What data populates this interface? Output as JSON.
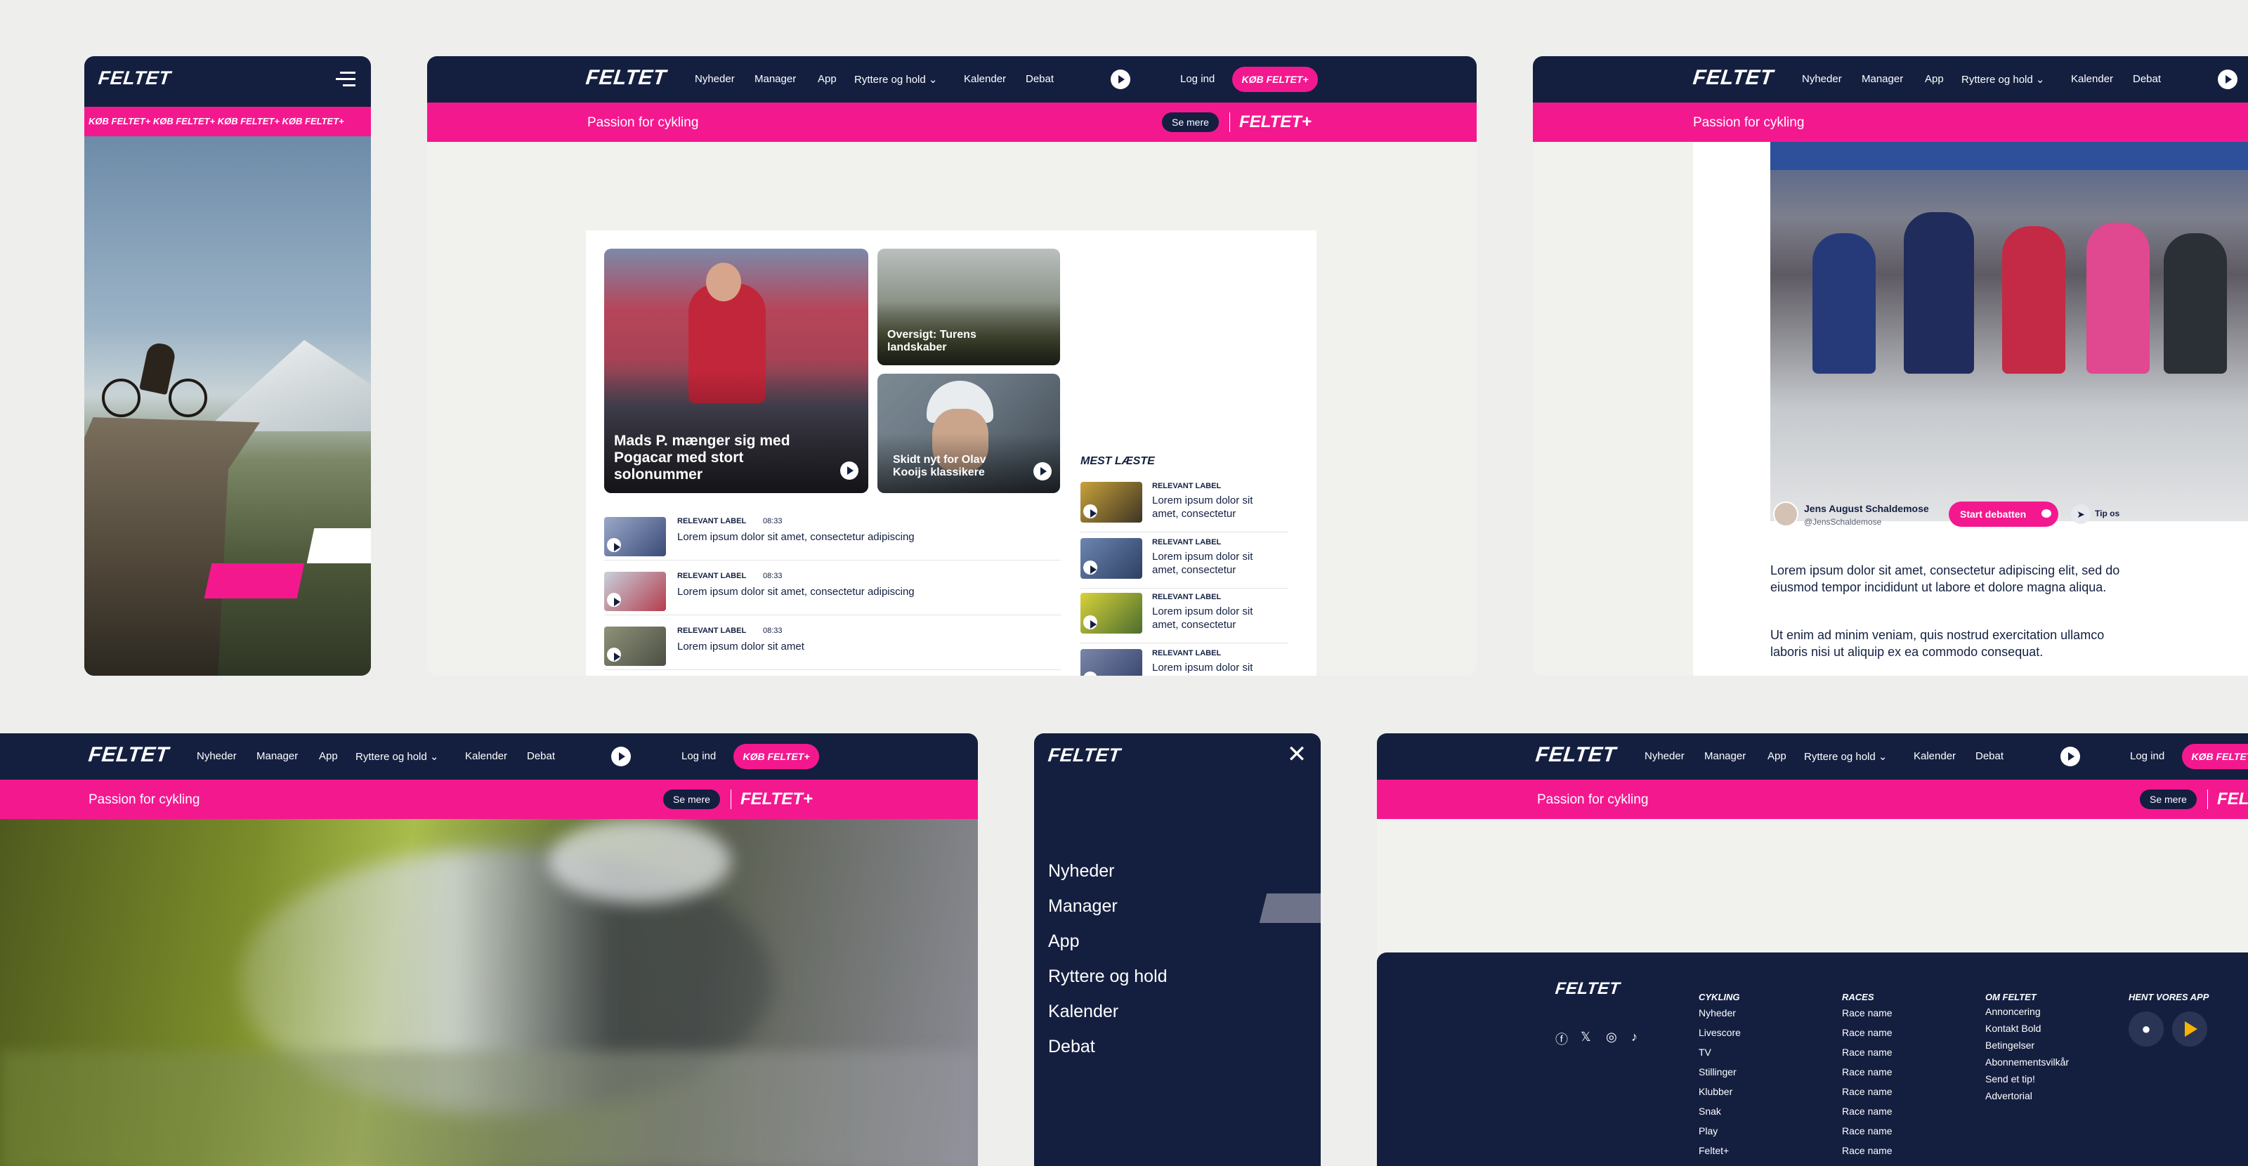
{
  "brand": "FELTET",
  "nav": {
    "items": [
      "Nyheder",
      "Manager",
      "App",
      "Ryttere og hold ⌄",
      "Kalender",
      "Debat"
    ],
    "login": "Log ind",
    "buy": "KØB FELTET+"
  },
  "bar": {
    "tagline": "Passion for cykling",
    "more": "Se mere",
    "plus": "FELTET+"
  },
  "mobile": {
    "ticker": "KØB FELTET+ KØB FELTET+ KØB FELTET+ KØB FELTET+"
  },
  "home": {
    "hero_caption": "Mads P. mænger sig med Pogacar med stort solonummer",
    "card2_caption": "Oversigt: Turens landskaber",
    "card3_caption": "Skidt nyt for Olav Kooijs klassikere",
    "list": [
      {
        "label": "RELEVANT LABEL",
        "time": "08:33",
        "text": "Lorem ipsum dolor sit amet, consectetur adipiscing"
      },
      {
        "label": "RELEVANT LABEL",
        "time": "08:33",
        "text": "Lorem ipsum dolor sit amet, consectetur adipiscing"
      },
      {
        "label": "RELEVANT LABEL",
        "time": "08:33",
        "text": "Lorem ipsum dolor sit amet"
      }
    ],
    "most_read_title": "MEST LÆSTE",
    "most_read": [
      {
        "label": "RELEVANT LABEL",
        "text": "Lorem ipsum dolor sit amet, consectetur"
      },
      {
        "label": "RELEVANT LABEL",
        "text": "Lorem ipsum dolor sit amet, consectetur"
      },
      {
        "label": "RELEVANT LABEL",
        "text": "Lorem ipsum dolor sit amet, consectetur"
      },
      {
        "label": "RELEVANT LABEL",
        "text": "Lorem ipsum dolor sit"
      }
    ]
  },
  "article": {
    "author": "Jens August Schaldemose",
    "handle": "@JensSchaldemose",
    "debate_button": "Start debatten",
    "tip": "Tip os",
    "p1": "Lorem ipsum dolor sit amet, consectetur adipiscing elit, sed do eiusmod tempor incididunt ut labore et dolore magna aliqua.",
    "p2": "Ut enim ad minim veniam, quis nostrud exercitation ullamco laboris nisi ut aliquip ex ea commodo consequat."
  },
  "menu": {
    "items": [
      "Nyheder",
      "Manager",
      "App",
      "Ryttere og hold",
      "Kalender",
      "Debat"
    ]
  },
  "footer": {
    "cols": [
      {
        "title": "CYKLING",
        "items": [
          "Nyheder",
          "Livescore",
          "TV",
          "Stillinger",
          "Klubber",
          "Snak",
          "Play",
          "Feltet+"
        ]
      },
      {
        "title": "RACES",
        "items": [
          "Race name",
          "Race name",
          "Race name",
          "Race name",
          "Race name",
          "Race name",
          "Race name",
          "Race name"
        ]
      },
      {
        "title": "OM FELTET",
        "items": [
          "Annoncering",
          "Kontakt Bold",
          "Betingelser",
          "Abonnementsvilkår",
          "Send et tip!",
          "Advertorial"
        ]
      }
    ],
    "app_title": "HENT VORES APP"
  },
  "colors": {
    "navy": "#141f40",
    "pink": "#f4188f",
    "bg": "#eeeeec"
  }
}
